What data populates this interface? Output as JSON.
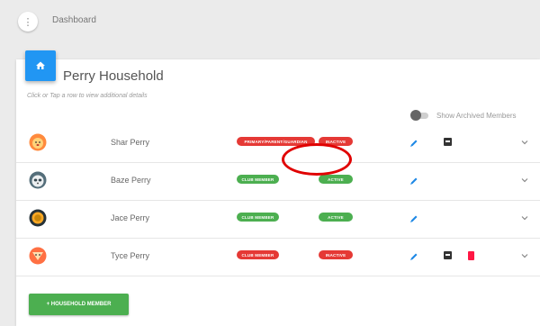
{
  "topbar": {
    "menu_icon": "more-vert-icon",
    "title": "Dashboard"
  },
  "household": {
    "home_icon": "home-icon",
    "title": "Perry Household",
    "hint": "Click or Tap a row to view additional details",
    "archive_toggle_label": "Show Archived Members",
    "archive_toggle_on": false
  },
  "members": [
    {
      "name": "Shar Perry",
      "avatar_icon": "lion-avatar-icon",
      "role": "PRIMARY/PARENT/GUARDIAN",
      "role_color": "#e53935",
      "status": "INACTIVE",
      "status_color": "#e53935",
      "has_archive": true,
      "has_delete": false
    },
    {
      "name": "Baze Perry",
      "avatar_icon": "panda-avatar-icon",
      "role": "CLUB MEMBER",
      "role_color": "#4caf50",
      "status": "ACTIVE",
      "status_color": "#4caf50",
      "has_archive": false,
      "has_delete": false
    },
    {
      "name": "Jace Perry",
      "avatar_icon": "monkey-avatar-icon",
      "role": "CLUB MEMBER",
      "role_color": "#4caf50",
      "status": "ACTIVE",
      "status_color": "#4caf50",
      "has_archive": false,
      "has_delete": false
    },
    {
      "name": "Tyce Perry",
      "avatar_icon": "fox-avatar-icon",
      "role": "CLUB MEMBER",
      "role_color": "#e53935",
      "status": "INACTIVE",
      "status_color": "#e53935",
      "has_archive": true,
      "has_delete": true
    }
  ],
  "add_button": {
    "label": "+ HOUSEHOLD MEMBER"
  },
  "colors": {
    "accent": "#2196f3",
    "success": "#4caf50",
    "danger": "#e53935",
    "annotation": "#e00000"
  }
}
